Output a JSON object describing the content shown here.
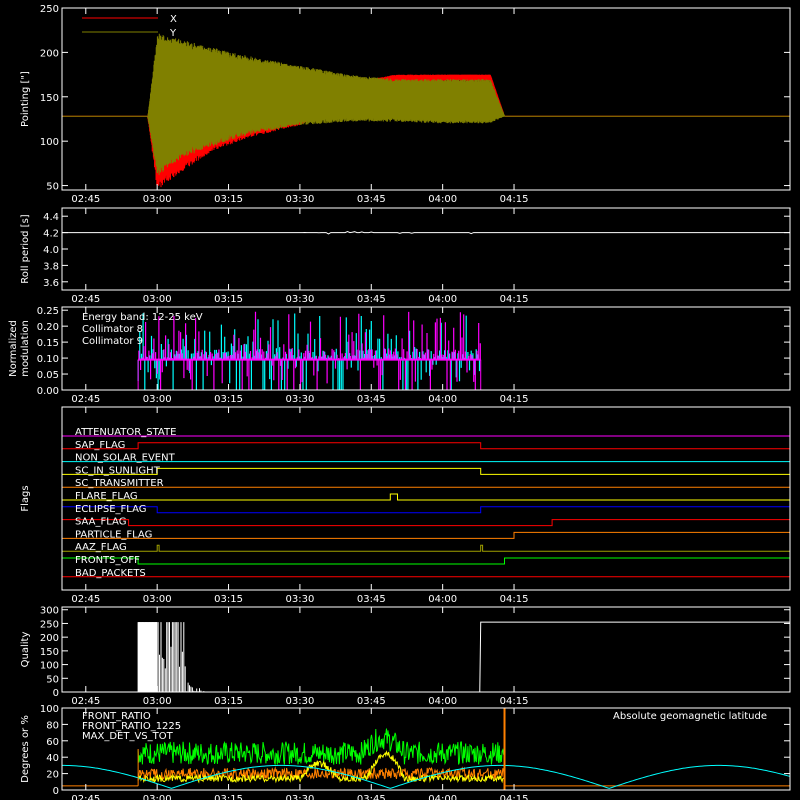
{
  "time_ticks": [
    "02:45",
    "03:00",
    "03:15",
    "03:30",
    "03:45",
    "04:00",
    "04:15"
  ],
  "time_range_min": [
    -20,
    133
  ],
  "colors": {
    "background": "#000000",
    "axes": "#ffffff",
    "red": "#ff0000",
    "olive": "#808000",
    "cyan": "#00ffff",
    "magenta": "#ff00ff",
    "orange": "#ff8000",
    "yellow": "#ffff00",
    "blue": "#0000ff",
    "green": "#00ff00",
    "white": "#ffffff",
    "brown": "#a0a000"
  },
  "chart_data": [
    {
      "type": "line",
      "panel": "pointing",
      "ylabel": "Pointing [\"]",
      "ylim": [
        45,
        250
      ],
      "yticks": [
        50,
        100,
        150,
        200,
        250
      ],
      "legend_placement": "top-left",
      "series": [
        {
          "name": "X",
          "color": "#ff0000",
          "baseline": 128,
          "envelope": [
            [
              -20,
              128,
              128
            ],
            [
              -2,
              128,
              128
            ],
            [
              0,
              45,
              200
            ],
            [
              5,
              65,
              175
            ],
            [
              12,
              90,
              165
            ],
            [
              20,
              105,
              160
            ],
            [
              30,
              118,
              155
            ],
            [
              40,
              140,
              165
            ],
            [
              50,
              160,
              175
            ],
            [
              60,
              168,
              175
            ],
            [
              70,
              168,
              175
            ],
            [
              73,
              128,
              128
            ],
            [
              133,
              128,
              128
            ]
          ]
        },
        {
          "name": "Y",
          "color": "#808000",
          "baseline": 128,
          "envelope": [
            [
              -20,
              128,
              128
            ],
            [
              -2,
              128,
              128
            ],
            [
              0,
              60,
              222
            ],
            [
              5,
              80,
              215
            ],
            [
              12,
              95,
              205
            ],
            [
              20,
              108,
              195
            ],
            [
              30,
              118,
              185
            ],
            [
              40,
              122,
              175
            ],
            [
              50,
              122,
              170
            ],
            [
              60,
              120,
              170
            ],
            [
              70,
              120,
              170
            ],
            [
              73,
              128,
              128
            ],
            [
              133,
              128,
              128
            ]
          ]
        }
      ]
    },
    {
      "type": "line",
      "panel": "roll",
      "ylabel": "Roll period [s]",
      "ylim": [
        3.5,
        4.5
      ],
      "yticks": [
        "3.6",
        "3.8",
        "4.0",
        "4.2",
        "4.4"
      ],
      "series": [
        {
          "color": "#ffffff",
          "values": [
            [
              -20,
              4.2
            ],
            [
              133,
              4.2
            ]
          ]
        }
      ]
    },
    {
      "type": "bar",
      "panel": "modulation",
      "ylabel": [
        "Normalized",
        "modulation"
      ],
      "ylim": [
        0,
        0.26
      ],
      "yticks": [
        "0.00",
        "0.05",
        "0.10",
        "0.15",
        "0.20",
        "0.25"
      ],
      "annotation": "Energy band: 12-25 keV",
      "legend_placement": "top-left",
      "baseline_value": 0.095,
      "active_range": [
        -4,
        68
      ],
      "series": [
        {
          "name": "Collimator 8",
          "color": "#00ffff"
        },
        {
          "name": "Collimator 9",
          "color": "#ff00ff"
        }
      ]
    },
    {
      "type": "line",
      "panel": "flags",
      "ylabel": "Flags",
      "flags": [
        {
          "label": "ATTENUATOR_STATE",
          "color": "#ff00ff",
          "on": []
        },
        {
          "label": "SAP_FLAG",
          "color": "#ff0000",
          "on": [
            [
              -4,
              68
            ]
          ]
        },
        {
          "label": "NON_SOLAR_EVENT",
          "color": "#00ffff",
          "on": []
        },
        {
          "label": "SC_IN_SUNLIGHT",
          "color": "#ffff00",
          "on": [
            [
              0,
              68
            ]
          ]
        },
        {
          "label": "SC_TRANSMITTER",
          "color": "#ff8000",
          "on": []
        },
        {
          "label": "FLARE_FLAG",
          "color": "#ffff00",
          "on": [
            [
              49,
              50.5
            ]
          ]
        },
        {
          "label": "ECLIPSE_FLAG",
          "color": "#0000ff",
          "on": [
            [
              -20,
              0
            ],
            [
              68,
              133
            ]
          ]
        },
        {
          "label": "SAA_FLAG",
          "color": "#ff0000",
          "on": [
            [
              -20,
              -6
            ],
            [
              83,
              133
            ]
          ]
        },
        {
          "label": "PARTICLE_FLAG",
          "color": "#ff8000",
          "on": [
            [
              75,
              133
            ]
          ]
        },
        {
          "label": "AAZ_FLAG",
          "color": "#a0a000",
          "on": [
            [
              0,
              0.4
            ],
            [
              68,
              68.4
            ]
          ]
        },
        {
          "label": "FRONTS_OFF",
          "color": "#00ff00",
          "on": [
            [
              -20,
              -4
            ],
            [
              73,
              133
            ]
          ]
        },
        {
          "label": "BAD_PACKETS",
          "color": "#ff0000",
          "on": []
        }
      ]
    },
    {
      "type": "bar",
      "panel": "quality",
      "ylabel": "Quality",
      "ylim": [
        0,
        310
      ],
      "yticks": [
        "0",
        "50",
        "100",
        "150",
        "200",
        "250",
        "300"
      ],
      "series": [
        {
          "color": "#ffffff",
          "values": [
            [
              -4,
              255
            ],
            [
              -3,
              255
            ],
            [
              -2,
              255
            ],
            [
              -1,
              255
            ],
            [
              0,
              255
            ],
            [
              0.6,
              210
            ],
            [
              1.2,
              150
            ],
            [
              1.8,
              255
            ],
            [
              2.4,
              120
            ],
            [
              3,
              255
            ],
            [
              3.6,
              80
            ],
            [
              4.2,
              255
            ],
            [
              4.8,
              50
            ],
            [
              5.4,
              255
            ],
            [
              6,
              30
            ],
            [
              6.6,
              20
            ],
            [
              7.2,
              15
            ],
            [
              8,
              10
            ],
            [
              9,
              6
            ],
            [
              10,
              3
            ],
            [
              68,
              255
            ],
            [
              80,
              255
            ],
            [
              100,
              255
            ],
            [
              133,
              255
            ]
          ]
        }
      ]
    },
    {
      "type": "line",
      "panel": "ratios",
      "ylabel": "Degrees or %",
      "ylim": [
        0,
        100
      ],
      "yticks": [
        "0",
        "20",
        "40",
        "60",
        "80",
        "100"
      ],
      "legend_placement": "top-left",
      "series": [
        {
          "name": "FRONT_RATIO",
          "color": "#ffff00",
          "level": 15
        },
        {
          "name": "FRONT_RATIO_1225",
          "color": "#00ff00",
          "level": 45
        },
        {
          "name": "MAX_DET_VS_TOT",
          "color": "#ff8000",
          "level": 20
        },
        {
          "name": "Absolute geomagnetic latitude",
          "color": "#00ffff",
          "level": 15
        }
      ]
    }
  ]
}
